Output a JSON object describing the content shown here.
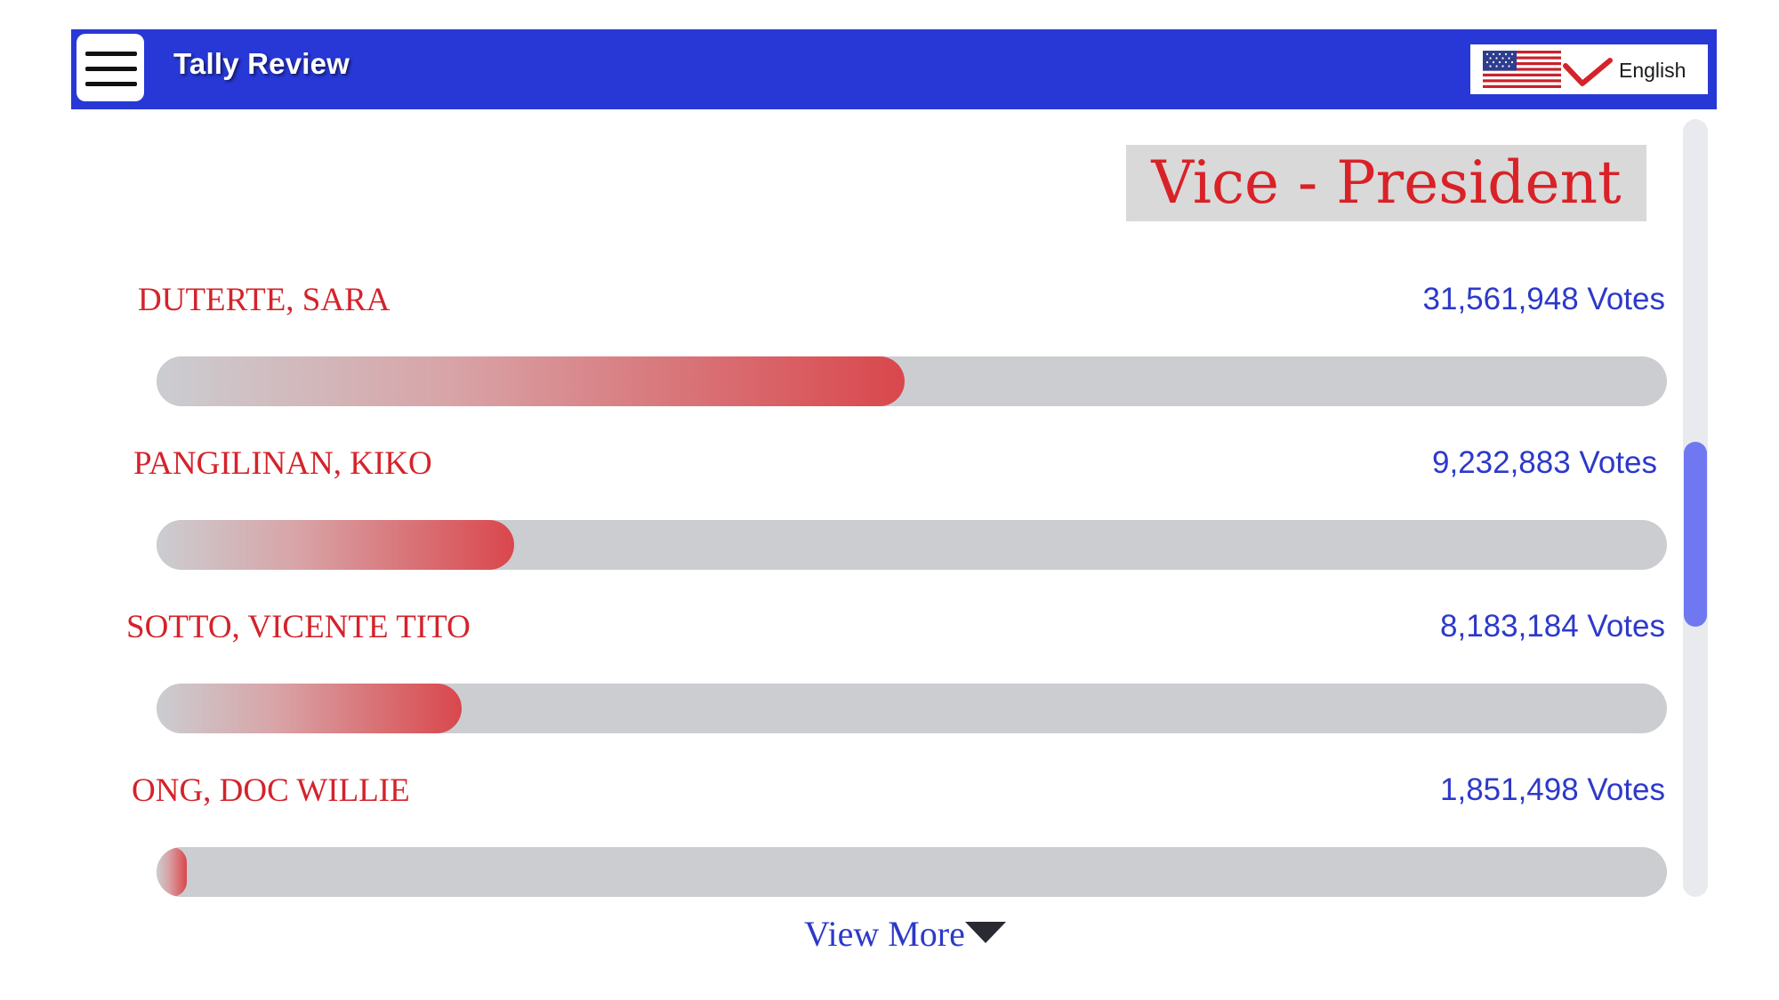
{
  "header": {
    "app_title": "Tally Review",
    "language_label": "English",
    "menu_icon": "hamburger-menu-icon",
    "flag_icon": "us-flag-icon",
    "check_icon": "checkmark-icon"
  },
  "section": {
    "title": "Vice - President"
  },
  "candidates": [
    {
      "name": "DUTERTE, SARA",
      "votes": "31,561,948 Votes",
      "share": 0.495
    },
    {
      "name": "PANGILINAN, KIKO",
      "votes": "9,232,883 Votes",
      "share": 0.237
    },
    {
      "name": "SOTTO, VICENTE TITO",
      "votes": "8,183,184 Votes",
      "share": 0.202
    },
    {
      "name": "ONG, DOC WILLIE",
      "votes": "1,851,498 Votes",
      "share": 0.02
    }
  ],
  "footer": {
    "view_more_label": "View More",
    "view_more_icon": "caret-down-icon"
  },
  "colors": {
    "header_bg": "#2738d6",
    "name_red": "#d4232a",
    "votes_blue": "#2c39c9",
    "bar_track": "#cbcdd1",
    "bar_fill": "#d9474c",
    "scroll_thumb": "#6f78f0"
  }
}
